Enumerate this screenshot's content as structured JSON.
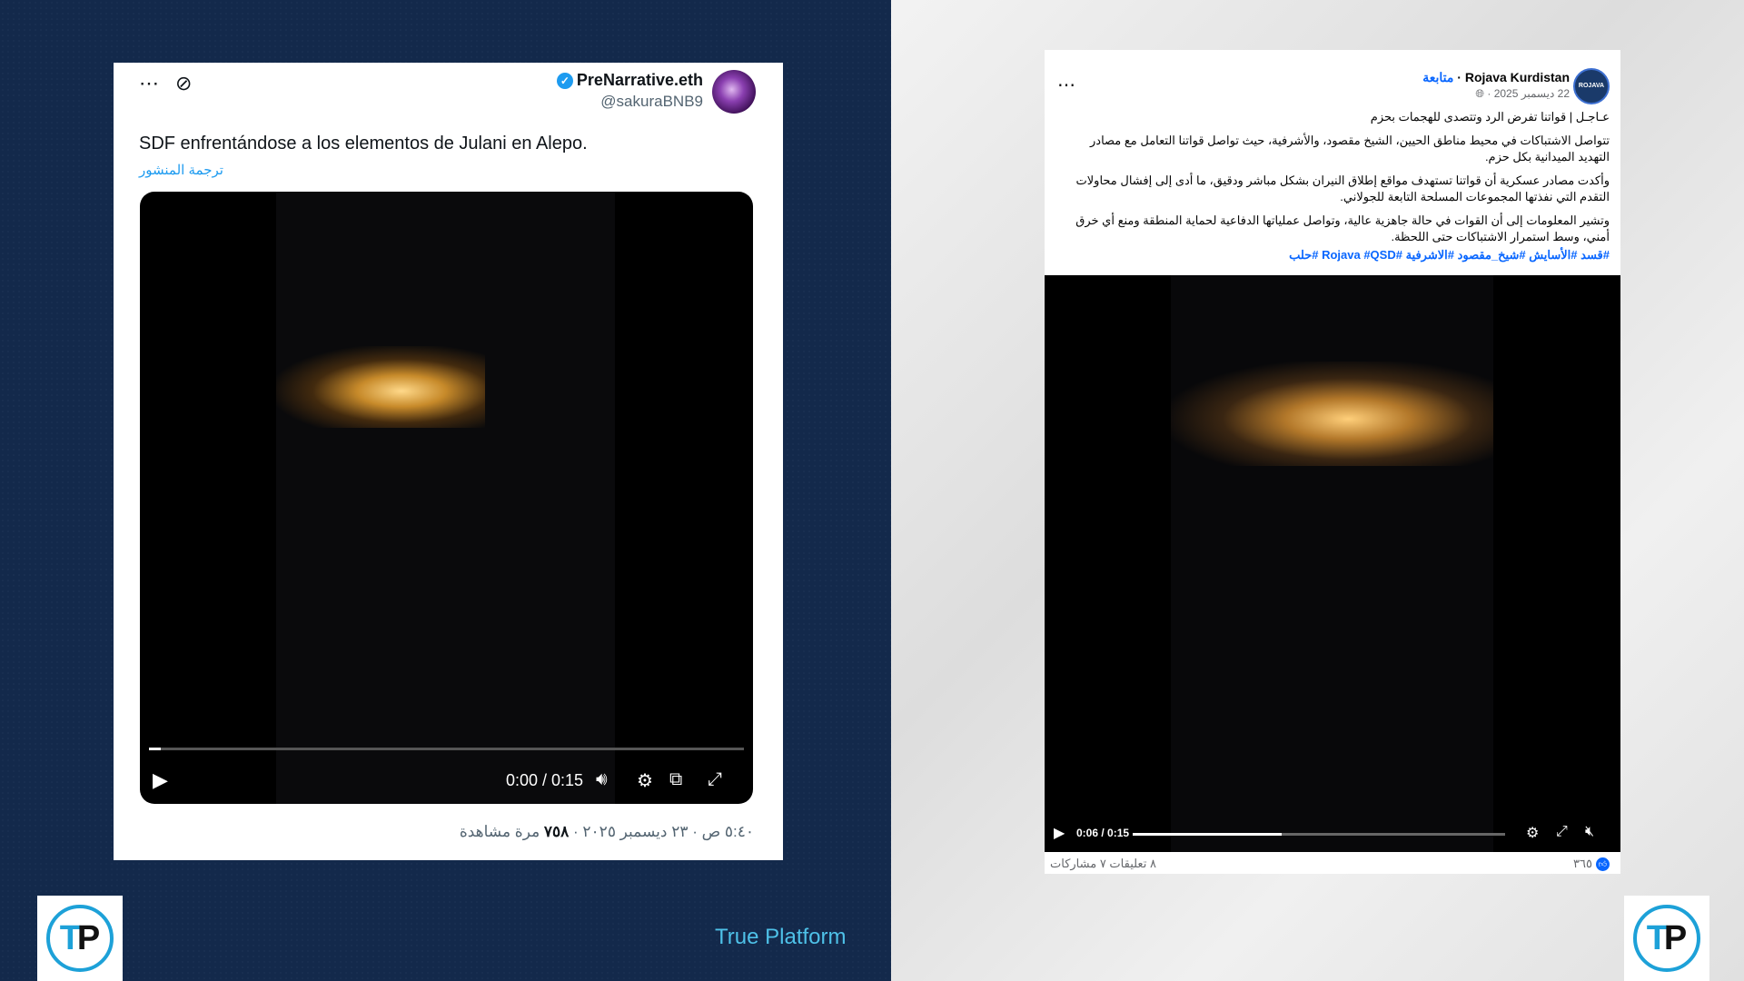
{
  "tweet": {
    "display_name": "PreNarrative.eth",
    "handle": "@sakuraBNB9",
    "text": "SDF enfrentándose a los elementos de Julani en Alepo.",
    "translate": "ترجمة المنشور",
    "video": {
      "time": "0:00 / 0:15",
      "progress": 0.02
    },
    "meta_time_date": "٥:٤٠ ص · ٢٣ ديسمبر ٢٠٢٥ · ",
    "meta_views": "٧٥٨",
    "meta_views_label": " مرة مشاهدة",
    "icons": [
      "more-icon",
      "grok-icon",
      "verified-badge-icon",
      "play-icon",
      "volume-icon",
      "settings-icon",
      "pip-icon",
      "fullscreen-icon"
    ]
  },
  "facebook": {
    "page_name": "Rojava Kurdistan",
    "follow": "متابعة",
    "avatar_text": "ROJAVA",
    "date": "22 ديسمبر 2025 · ",
    "paragraphs": [
      "عـاجـل | قواتنا تفرض الرد وتتصدى للهجمات بحزم",
      "تتواصل الاشتباكات في محيط مناطق الحيين، الشيخ مقصود، والأشرفية، حيث تواصل قواتنا التعامل مع مصادر التهديد الميدانية بكل حزم.",
      "وأكدت مصادر عسكرية أن قواتنا تستهدف مواقع إطلاق النيران بشكل مباشر ودقيق، ما أدى إلى إفشال محاولات التقدم التي نفذتها المجموعات المسلحة التابعة للجولاني.",
      "وتشير المعلومات إلى أن القوات في حالة جاهزية عالية، وتواصل عملياتها الدفاعية لحماية المنطقة ومنع أي خرق أمني، وسط استمرار الاشتباكات حتى اللحظة."
    ],
    "hashtags": "#قسد #الأسايش #شيخ_مقصود #الاشرفية #Rojava #QSD #حلب",
    "video": {
      "time": "0:06 / 0:15",
      "progress": 0.4
    },
    "likes": "٣٦٥",
    "comments": "٨ تعليقات",
    "shares": "٧ مشاركات",
    "icons": [
      "more-icon",
      "globe-icon",
      "like-icon",
      "play-icon",
      "settings-icon",
      "fullscreen-icon",
      "mute-icon"
    ]
  },
  "brand": "True Platform",
  "logo": {
    "t": "T",
    "p": "P"
  },
  "colors": {
    "left_bg": "#13294b",
    "right_bg": "#e6e6e6",
    "accent": "#1da1d8",
    "brand_text": "#4ec1e8"
  }
}
